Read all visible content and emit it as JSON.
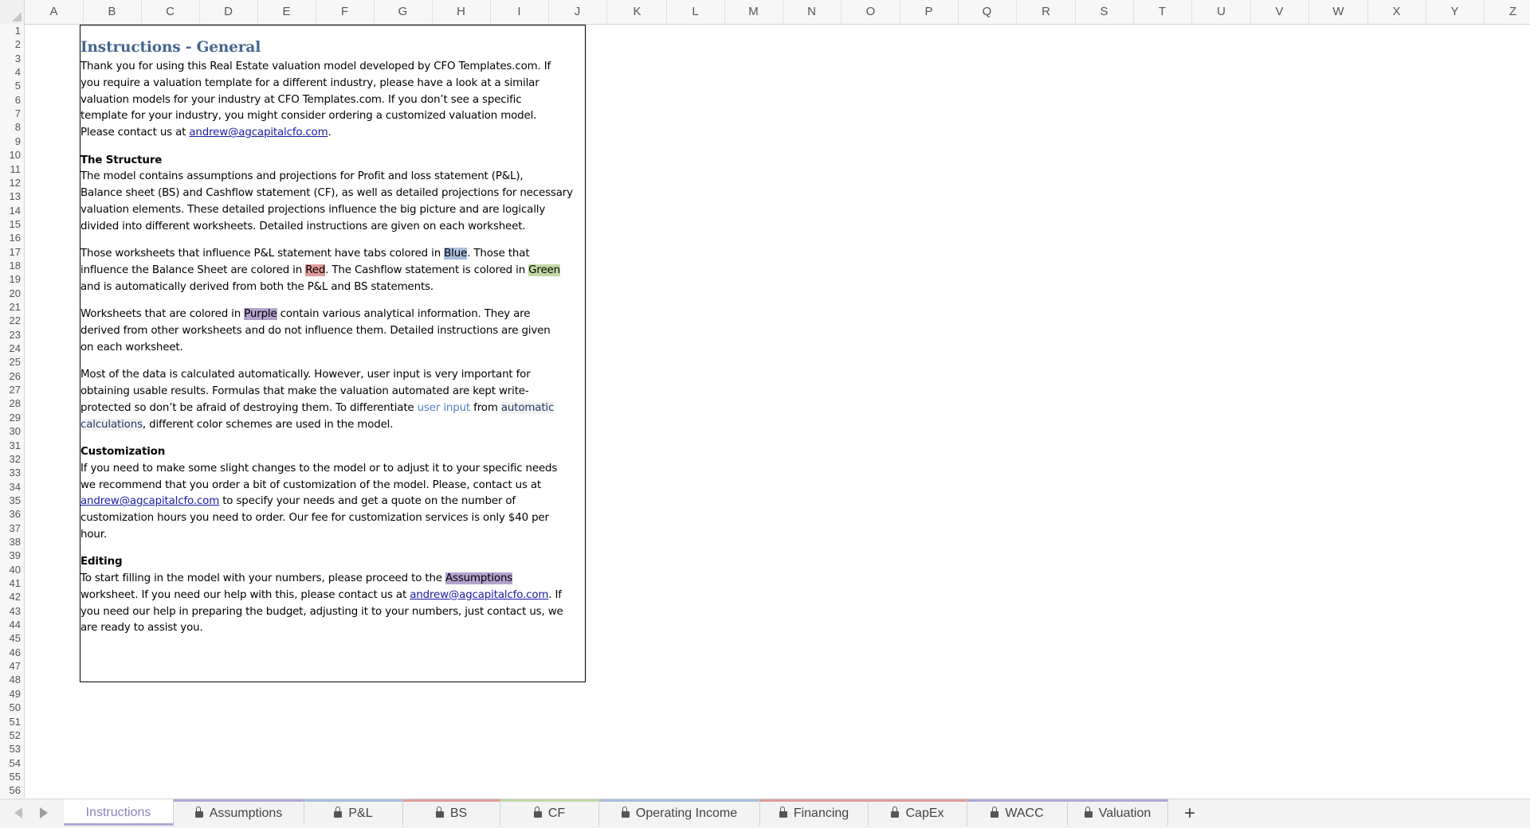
{
  "columns": [
    "A",
    "B",
    "C",
    "D",
    "E",
    "F",
    "G",
    "H",
    "I",
    "J",
    "K",
    "L",
    "M",
    "N",
    "O",
    "P",
    "Q",
    "R",
    "S",
    "T",
    "U",
    "V",
    "W",
    "X",
    "Y",
    "Z"
  ],
  "rows": [
    "1",
    "2",
    "3",
    "4",
    "5",
    "6",
    "7",
    "8",
    "9",
    "10",
    "11",
    "12",
    "13",
    "14",
    "15",
    "16",
    "17",
    "18",
    "19",
    "20",
    "21",
    "22",
    "23",
    "24",
    "25",
    "26",
    "27",
    "28",
    "29",
    "30",
    "31",
    "32",
    "33",
    "34",
    "35",
    "36",
    "37",
    "38",
    "39",
    "40",
    "41",
    "42",
    "43",
    "44",
    "45",
    "46",
    "47",
    "48",
    "49",
    "50",
    "51",
    "52",
    "53",
    "54",
    "55",
    "56"
  ],
  "doc": {
    "title": "Instructions - General",
    "intro": {
      "l1": "Thank you for using this Real Estate valuation model developed by CFO Templates.com. If",
      "l2": "you require a valuation template for a different industry, please have a look at a similar",
      "l3": "valuation models for your industry at CFO Templates.com. If you don’t see a specific",
      "l4": "template for your industry, you might consider ordering a customized valuation model.",
      "l5a": "Please contact us at ",
      "email": "andrew@agcapitalcfo.com",
      "l5b": "."
    },
    "structure": {
      "heading": "The Structure",
      "l1": "The model contains assumptions and projections for Profit and loss statement (P&L),",
      "l2": "Balance sheet (BS) and Cashflow statement (CF), as well as detailed projections for necessary",
      "l3": "valuation elements. These detailed projections influence the big picture and are logically",
      "l4": "divided into different worksheets. Detailed instructions are given on each worksheet."
    },
    "colors": {
      "l1a": "Those worksheets that influence P&L statement have tabs colored in ",
      "blue": "Blue",
      "l1b": ". Those that",
      "l2a": "influence the  Balance Sheet are colored in ",
      "red": "Red",
      "l2b": ". The Cashflow statement is colored in ",
      "green": "Green",
      "l3": "and is automatically derived from both the P&L and BS statements."
    },
    "purple": {
      "l1a": "Worksheets that are colored in ",
      "purple": "Purple",
      "l1b": " contain various analytical information. They are",
      "l2": "derived from other worksheets and do not influence them. Detailed instructions are given",
      "l3": "on each worksheet."
    },
    "data": {
      "l1": "Most of the data is calculated automatically. However, user input is very important for",
      "l2": "obtaining usable results. Formulas that make the valuation automated are kept write-",
      "l3a": "protected so don’t be afraid of destroying them. To differentiate ",
      "user_input": "user input",
      "l3b": " from ",
      "automatic": "automatic",
      "calculations": "calculations",
      "l4b": ", different color schemes are used in the model."
    },
    "customization": {
      "heading": "Customization",
      "l1": "If you need to make some slight changes to the model or to adjust it to your specific needs",
      "l2": "we recommend that you order a bit of customization of the model. Please, contact us at",
      "email": "andrew@agcapitalcfo.com",
      "l3b": " to specify your needs and get a quote on the number of",
      "l4": "customization hours you need to order. Our fee for customization services is only $40 per",
      "l5": "hour."
    },
    "editing": {
      "heading": "Editing",
      "l1a": "To start filling in the model with your numbers, please proceed to the ",
      "assumptions": "Assumptions",
      "l2a": "worksheet. If you need our help with this, please contact us at ",
      "email": "andrew@agcapitalcfo.com",
      "l2b": ". If",
      "l3": "you need our help in preparing the budget, adjusting it to your numbers, just contact us, we",
      "l4": "are ready to assist you."
    }
  },
  "tabs": [
    {
      "label": "Instructions",
      "locked": false,
      "active": true,
      "color": "#b2a6d6"
    },
    {
      "label": "Assumptions",
      "locked": true,
      "active": false,
      "color": "#b2a6d6"
    },
    {
      "label": "P&L",
      "locked": true,
      "active": false,
      "color": "#a8bedb"
    },
    {
      "label": "BS",
      "locked": true,
      "active": false,
      "color": "#e09b9b"
    },
    {
      "label": "CF",
      "locked": true,
      "active": false,
      "color": "#c2d8a4"
    },
    {
      "label": "Operating Income",
      "locked": true,
      "active": false,
      "color": "#a8bedb"
    },
    {
      "label": "Financing",
      "locked": true,
      "active": false,
      "color": "#e09b9b"
    },
    {
      "label": "CapEx",
      "locked": true,
      "active": false,
      "color": "#e09b9b"
    },
    {
      "label": "WACC",
      "locked": true,
      "active": false,
      "color": "#b2a6d6"
    },
    {
      "label": "Valuation",
      "locked": true,
      "active": false,
      "color": "#b2a6d6"
    }
  ],
  "add_tab_label": "+"
}
